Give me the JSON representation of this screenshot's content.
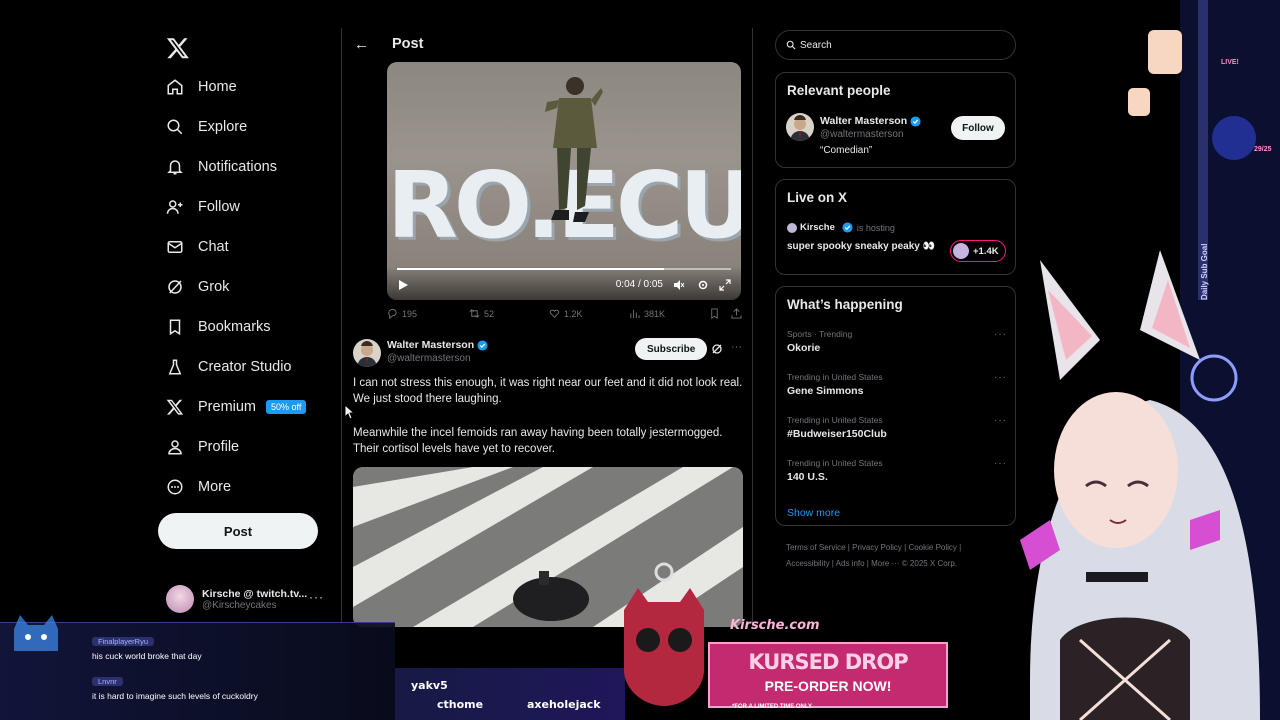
{
  "nav": {
    "items": [
      {
        "label": "Home",
        "icon": "home-icon"
      },
      {
        "label": "Explore",
        "icon": "search-icon"
      },
      {
        "label": "Notifications",
        "icon": "bell-icon"
      },
      {
        "label": "Follow",
        "icon": "add-person-icon"
      },
      {
        "label": "Chat",
        "icon": "mail-icon"
      },
      {
        "label": "Grok",
        "icon": "grok-icon"
      },
      {
        "label": "Bookmarks",
        "icon": "bookmark-icon"
      },
      {
        "label": "Creator Studio",
        "icon": "flask-icon"
      },
      {
        "label": "Premium",
        "icon": "x-logo-icon",
        "badge": "50% off"
      },
      {
        "label": "Profile",
        "icon": "person-icon"
      },
      {
        "label": "More",
        "icon": "more-circle-icon"
      }
    ],
    "post_label": "Post",
    "account": {
      "name": "Kirsche @ twitch.tv...",
      "handle": "@Kirscheycakes"
    }
  },
  "header": {
    "title": "Post"
  },
  "video": {
    "time": "0:04 / 0:05",
    "progress": 0.8,
    "overlay_text": "RO.ECU"
  },
  "post_actions": {
    "replies": "195",
    "reposts": "52",
    "likes": "1.2K",
    "views": "381K"
  },
  "reply": {
    "name": "Walter Masterson",
    "handle": "@waltermasterson",
    "subscribe_label": "Subscribe",
    "text1": "I can not stress this enough, it was right near our feet and it did not look real. We just stood there laughing.",
    "text2": "Meanwhile the incel femoids ran away having been totally jestermogged. Their cortisol levels have yet to recover."
  },
  "sidebar": {
    "search_placeholder": "Search",
    "relevant": {
      "title": "Relevant people",
      "name": "Walter Masterson",
      "handle": "@waltermasterson",
      "bio": "“Comedian”",
      "follow_label": "Follow"
    },
    "live": {
      "title": "Live on X",
      "host": "Kirsche",
      "host_status": "is hosting",
      "stream_title": "super spooky sneaky peaky 👀",
      "count": "+1.4K"
    },
    "happening": {
      "title": "What’s happening",
      "trends": [
        {
          "context": "Sports · Trending",
          "name": "Okorie"
        },
        {
          "context": "Trending in United States",
          "name": "Gene Simmons"
        },
        {
          "context": "Trending in United States",
          "name": "#Budweiser150Club"
        },
        {
          "context": "Trending in United States",
          "name": "140 U.S."
        }
      ],
      "show_more": "Show more"
    },
    "footer": {
      "links": [
        "Terms of Service",
        "Privacy Policy",
        "Cookie Policy",
        "Accessibility",
        "Ads info",
        "More ···"
      ],
      "copyright": "© 2025 X Corp."
    }
  },
  "stream": {
    "chat": [
      {
        "user": "FinalplayerRyu",
        "message": "his cuck world broke that day"
      },
      {
        "user": "Lnvnr",
        "message": "it is hard to imagine such levels of cuckoldry"
      }
    ],
    "viewers": [
      "yakv5",
      "cthome",
      "axeholejack"
    ],
    "promo": {
      "site": "Kirsche.com",
      "title": "KURSED DROP",
      "subtitle": "PRE-ORDER NOW!",
      "note": "*FOR A LIMITED TIME ONLY"
    },
    "goal_label": "Daily Sub Goal",
    "goal_count": "29/25",
    "live_tag": "LIVE!"
  },
  "colors": {
    "accent": "#1d9bf0",
    "background": "#000000",
    "border": "#2f3336",
    "muted": "#71767b",
    "live_pink": "#f91880"
  }
}
